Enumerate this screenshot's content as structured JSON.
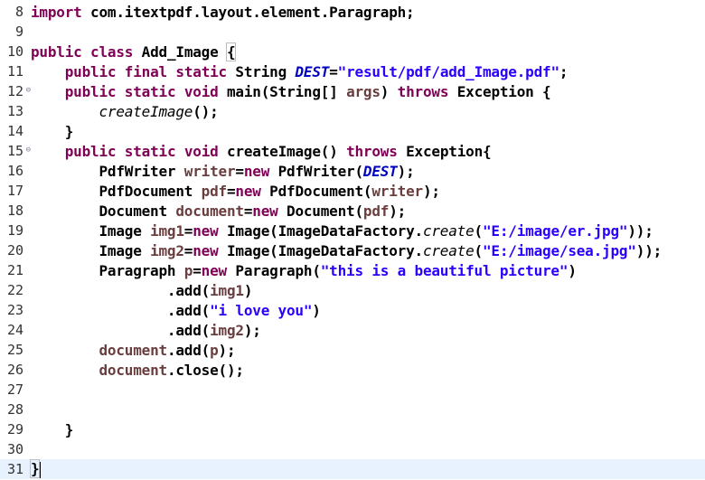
{
  "editor": {
    "lines": [
      {
        "num": "8",
        "fold": "",
        "tokens": [
          {
            "t": "import",
            "c": "kw"
          },
          {
            "t": " com.itextpdf.layout.element.Paragraph;",
            "c": ""
          }
        ]
      },
      {
        "num": "9",
        "fold": "",
        "tokens": []
      },
      {
        "num": "10",
        "fold": "",
        "tokens": [
          {
            "t": "public",
            "c": "kw"
          },
          {
            "t": " ",
            "c": ""
          },
          {
            "t": "class",
            "c": "kw"
          },
          {
            "t": " Add_Image ",
            "c": ""
          },
          {
            "t": "{",
            "c": "bm"
          }
        ]
      },
      {
        "num": "11",
        "fold": "",
        "tokens": [
          {
            "t": "    ",
            "c": ""
          },
          {
            "t": "public",
            "c": "kw"
          },
          {
            "t": " ",
            "c": ""
          },
          {
            "t": "final",
            "c": "kw"
          },
          {
            "t": " ",
            "c": ""
          },
          {
            "t": "static",
            "c": "kw"
          },
          {
            "t": " String ",
            "c": ""
          },
          {
            "t": "DEST",
            "c": "fi"
          },
          {
            "t": "=",
            "c": ""
          },
          {
            "t": "\"result/pdf/add_Image.pdf\"",
            "c": "st"
          },
          {
            "t": ";",
            "c": ""
          }
        ]
      },
      {
        "num": "12",
        "fold": "⊖",
        "tokens": [
          {
            "t": "    ",
            "c": ""
          },
          {
            "t": "public",
            "c": "kw"
          },
          {
            "t": " ",
            "c": ""
          },
          {
            "t": "static",
            "c": "kw"
          },
          {
            "t": " ",
            "c": ""
          },
          {
            "t": "void",
            "c": "kw"
          },
          {
            "t": " main(String[] ",
            "c": ""
          },
          {
            "t": "args",
            "c": "lv"
          },
          {
            "t": ") ",
            "c": ""
          },
          {
            "t": "throws",
            "c": "kw"
          },
          {
            "t": " Exception {",
            "c": ""
          }
        ]
      },
      {
        "num": "13",
        "fold": "",
        "tokens": [
          {
            "t": "        ",
            "c": ""
          },
          {
            "t": "createImage",
            "c": "it"
          },
          {
            "t": "();",
            "c": ""
          }
        ]
      },
      {
        "num": "14",
        "fold": "",
        "tokens": [
          {
            "t": "    }",
            "c": ""
          }
        ]
      },
      {
        "num": "15",
        "fold": "⊖",
        "tokens": [
          {
            "t": "    ",
            "c": ""
          },
          {
            "t": "public",
            "c": "kw"
          },
          {
            "t": " ",
            "c": ""
          },
          {
            "t": "static",
            "c": "kw"
          },
          {
            "t": " ",
            "c": ""
          },
          {
            "t": "void",
            "c": "kw"
          },
          {
            "t": " createImage() ",
            "c": ""
          },
          {
            "t": "throws",
            "c": "kw"
          },
          {
            "t": " Exception{",
            "c": ""
          }
        ]
      },
      {
        "num": "16",
        "fold": "",
        "tokens": [
          {
            "t": "        PdfWriter ",
            "c": ""
          },
          {
            "t": "writer",
            "c": "lv"
          },
          {
            "t": "=",
            "c": ""
          },
          {
            "t": "new",
            "c": "kw"
          },
          {
            "t": " PdfWriter(",
            "c": ""
          },
          {
            "t": "DEST",
            "c": "fi"
          },
          {
            "t": ");",
            "c": ""
          }
        ]
      },
      {
        "num": "17",
        "fold": "",
        "tokens": [
          {
            "t": "        PdfDocument ",
            "c": ""
          },
          {
            "t": "pdf",
            "c": "lv"
          },
          {
            "t": "=",
            "c": ""
          },
          {
            "t": "new",
            "c": "kw"
          },
          {
            "t": " PdfDocument(",
            "c": ""
          },
          {
            "t": "writer",
            "c": "lv"
          },
          {
            "t": ");",
            "c": ""
          }
        ]
      },
      {
        "num": "18",
        "fold": "",
        "tokens": [
          {
            "t": "        Document ",
            "c": ""
          },
          {
            "t": "document",
            "c": "lv"
          },
          {
            "t": "=",
            "c": ""
          },
          {
            "t": "new",
            "c": "kw"
          },
          {
            "t": " Document(",
            "c": ""
          },
          {
            "t": "pdf",
            "c": "lv"
          },
          {
            "t": ");",
            "c": ""
          }
        ]
      },
      {
        "num": "19",
        "fold": "",
        "tokens": [
          {
            "t": "        Image ",
            "c": ""
          },
          {
            "t": "img1",
            "c": "lv"
          },
          {
            "t": "=",
            "c": ""
          },
          {
            "t": "new",
            "c": "kw"
          },
          {
            "t": " Image(ImageDataFactory.",
            "c": ""
          },
          {
            "t": "create",
            "c": "it"
          },
          {
            "t": "(",
            "c": ""
          },
          {
            "t": "\"E:/image/er.jpg\"",
            "c": "st"
          },
          {
            "t": "));",
            "c": ""
          }
        ]
      },
      {
        "num": "20",
        "fold": "",
        "tokens": [
          {
            "t": "        Image ",
            "c": ""
          },
          {
            "t": "img2",
            "c": "lv"
          },
          {
            "t": "=",
            "c": ""
          },
          {
            "t": "new",
            "c": "kw"
          },
          {
            "t": " Image(ImageDataFactory.",
            "c": ""
          },
          {
            "t": "create",
            "c": "it"
          },
          {
            "t": "(",
            "c": ""
          },
          {
            "t": "\"E:/image/sea.jpg\"",
            "c": "st"
          },
          {
            "t": "));",
            "c": ""
          }
        ]
      },
      {
        "num": "21",
        "fold": "",
        "tokens": [
          {
            "t": "        Paragraph ",
            "c": ""
          },
          {
            "t": "p",
            "c": "lv"
          },
          {
            "t": "=",
            "c": ""
          },
          {
            "t": "new",
            "c": "kw"
          },
          {
            "t": " Paragraph(",
            "c": ""
          },
          {
            "t": "\"this is a beautiful picture\"",
            "c": "st"
          },
          {
            "t": ")",
            "c": ""
          }
        ]
      },
      {
        "num": "22",
        "fold": "",
        "tokens": [
          {
            "t": "                .add(",
            "c": ""
          },
          {
            "t": "img1",
            "c": "lv"
          },
          {
            "t": ")",
            "c": ""
          }
        ]
      },
      {
        "num": "23",
        "fold": "",
        "tokens": [
          {
            "t": "                .add(",
            "c": ""
          },
          {
            "t": "\"i love you\"",
            "c": "st"
          },
          {
            "t": ")",
            "c": ""
          }
        ]
      },
      {
        "num": "24",
        "fold": "",
        "tokens": [
          {
            "t": "                .add(",
            "c": ""
          },
          {
            "t": "img2",
            "c": "lv"
          },
          {
            "t": ");",
            "c": ""
          }
        ]
      },
      {
        "num": "25",
        "fold": "",
        "tokens": [
          {
            "t": "        ",
            "c": ""
          },
          {
            "t": "document",
            "c": "lv"
          },
          {
            "t": ".add(",
            "c": ""
          },
          {
            "t": "p",
            "c": "lv"
          },
          {
            "t": ");",
            "c": ""
          }
        ]
      },
      {
        "num": "26",
        "fold": "",
        "tokens": [
          {
            "t": "        ",
            "c": ""
          },
          {
            "t": "document",
            "c": "lv"
          },
          {
            "t": ".close();",
            "c": ""
          }
        ]
      },
      {
        "num": "27",
        "fold": "",
        "tokens": []
      },
      {
        "num": "28",
        "fold": "",
        "tokens": []
      },
      {
        "num": "29",
        "fold": "",
        "tokens": [
          {
            "t": "    }",
            "c": ""
          }
        ]
      },
      {
        "num": "30",
        "fold": "",
        "tokens": []
      },
      {
        "num": "31",
        "fold": "",
        "tokens": [
          {
            "t": "}",
            "c": "bm"
          }
        ],
        "current": true,
        "cursor": true
      }
    ]
  },
  "colors": {
    "keyword": "#7f0055",
    "string": "#2a00ff",
    "static_field": "#0000c0",
    "local_variable": "#6a3e3e",
    "current_line": "#e8f2fe"
  }
}
